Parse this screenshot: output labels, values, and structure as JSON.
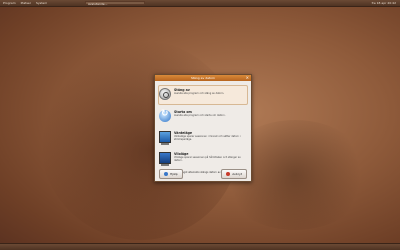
{
  "top_panel": {
    "menus": [
      "Program",
      "Platser",
      "System"
    ],
    "task_title": "Avslutande...",
    "tray": "fre 18 apr 20:42"
  },
  "dialog": {
    "title": "Stäng av datorn",
    "options": [
      {
        "label": "Stäng av",
        "desc": "Avsluta alla program och stäng av datorn.",
        "icon": "power-icon"
      },
      {
        "label": "Starta om",
        "desc": "Avsluta alla program och starta om datorn.",
        "icon": "restart-icon"
      },
      {
        "label": "Vänteläge",
        "desc": "Vänteläge sparar sessionen i minnet och sätter datorn i strömsparläge.",
        "icon": "sleep-icon"
      },
      {
        "label": "Viloläge",
        "desc": "Viloläge sparar sessionen på hårddisken och stänger av datorn.",
        "icon": "hibernate-icon"
      }
    ],
    "note": "Om du inte väljer något alternativ stängs datorn av automatiskt om 60 sekunder.",
    "help_label": "Hjälp",
    "cancel_label": "Avbryt"
  },
  "colors": {
    "titlebar": "#c8742c",
    "wallpaper": "#8e5a3a"
  }
}
